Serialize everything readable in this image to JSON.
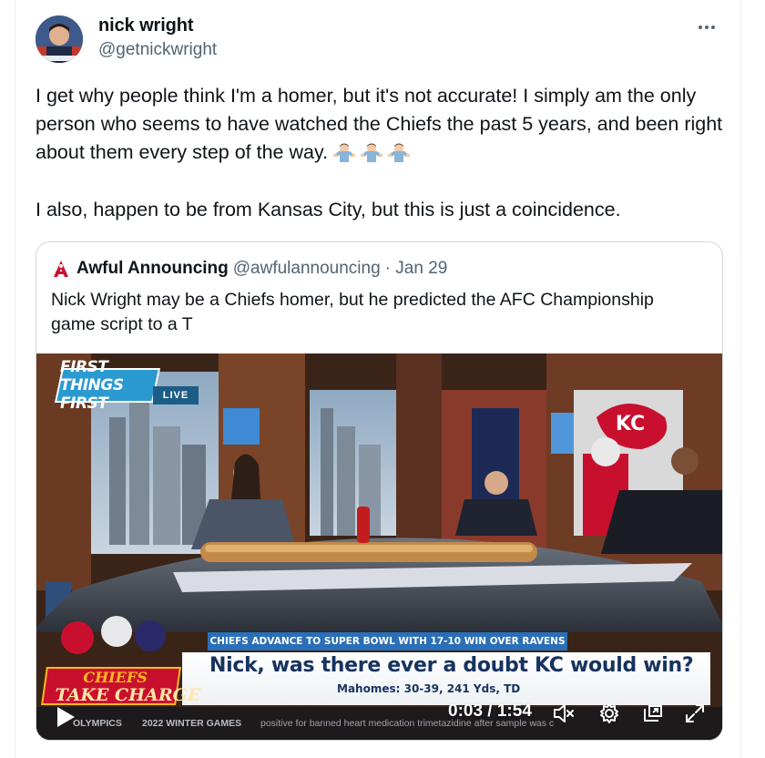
{
  "author": {
    "name": "nick wright",
    "handle": "@getnickwright"
  },
  "tweet": {
    "paragraph1": "I get why people think I'm a homer, but it's not accurate! I simply am the only person who seems to have watched the Chiefs the past 5 years, and been right about them every step of the way.",
    "emoji_name": "man-shrugging-emoji",
    "paragraph2": "I also, happen to be from Kansas City, but this is just a coincidence."
  },
  "quoted": {
    "name": "Awful Announcing",
    "handle": "@awfulannouncing",
    "date": "· Jan 29",
    "text": "Nick Wright may be a Chiefs homer, but he predicted the AFC Championship game script to a T"
  },
  "video": {
    "show_badge": "FIRST THINGS FIRST",
    "live_label": "LIVE",
    "ticker_top": "CHIEFS ADVANCE TO SUPER BOWL WITH 17-10 WIN OVER RAVENS",
    "headline": "Nick, was there ever a doubt KC would win?",
    "subline": "Mahomes: 30-39, 241 Yds, TD",
    "tag_line1": "CHIEFS",
    "tag_line2": "TAKE CHARGE",
    "bar_left": "OLYMPICS",
    "bar_mid": "2022 WINTER GAMES",
    "bar_ticker": "positive for banned heart medication trimetazidine after sample was c",
    "time": "0:03 / 1:54"
  },
  "colors": {
    "text_primary": "#0f1419",
    "text_secondary": "#536471",
    "border": "#cfd9de",
    "headline_navy": "#16335f",
    "ticker_blue": "#2a6fb8",
    "chiefs_red": "#c8102e",
    "chiefs_gold": "#ffb81c"
  }
}
